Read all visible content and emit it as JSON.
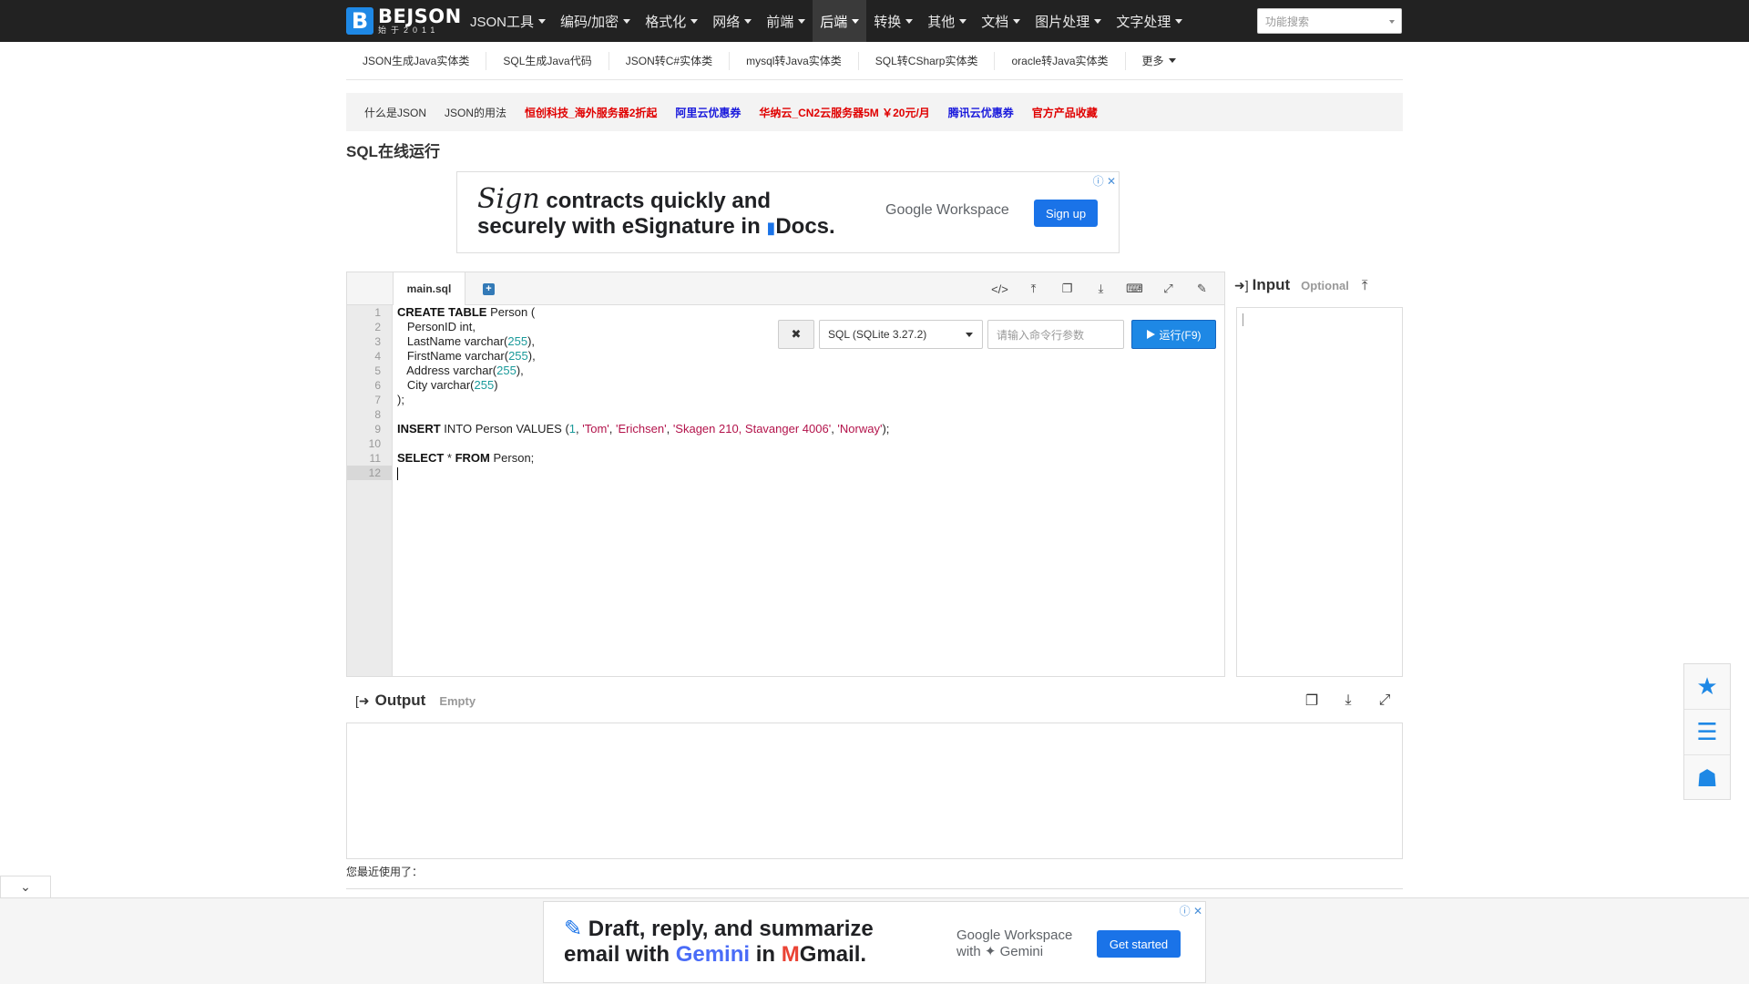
{
  "brand": {
    "name": "BEJSON",
    "tagline": "始于2011"
  },
  "nav": {
    "items": [
      "JSON工具",
      "编码/加密",
      "格式化",
      "网络",
      "前端",
      "后端",
      "转换",
      "其他",
      "文档",
      "图片处理",
      "文字处理"
    ],
    "active_index": 5,
    "search_placeholder": "功能搜索"
  },
  "subnav": [
    "JSON生成Java实体类",
    "SQL生成Java代码",
    "JSON转C#实体类",
    "mysql转Java实体类",
    "SQL转CSharp实体类",
    "oracle转Java实体类",
    "更多"
  ],
  "links": [
    {
      "text": "什么是JSON",
      "style": "plain"
    },
    {
      "text": "JSON的用法",
      "style": "plain"
    },
    {
      "text": "恒创科技_海外服务器2折起",
      "style": "red"
    },
    {
      "text": "阿里云优惠券",
      "style": "blue"
    },
    {
      "text": "华纳云_CN2云服务器5M ￥20元/月",
      "style": "red"
    },
    {
      "text": "腾讯云优惠券",
      "style": "blue"
    },
    {
      "text": "官方产品收藏",
      "style": "red"
    }
  ],
  "page_title": "SQL在线运行",
  "ad_top": {
    "script_word": "Sign",
    "line1": "contracts quickly and",
    "line2": "securely with eSignature in ",
    "line2_end": "Docs.",
    "brand": "Google Workspace",
    "button": "Sign up"
  },
  "editor": {
    "tab": "main.sql",
    "line_numbers": [
      "1",
      "2",
      "3",
      "4",
      "5",
      "6",
      "7",
      "8",
      "9",
      "10",
      "11",
      "12"
    ],
    "clear_label": "✖",
    "language": "SQL (SQLite 3.27.2)",
    "args_placeholder": "请输入命令行参数",
    "run_label": "运行(F9)"
  },
  "input_panel": {
    "title": "Input",
    "hint": "Optional"
  },
  "output_panel": {
    "title": "Output",
    "status": "Empty"
  },
  "recent_label": "您最近使用了：",
  "ad_bottom": {
    "line1": "Draft, reply, and summarize",
    "line2a": "email with ",
    "line2b": "Gemini",
    "line2c": " in ",
    "line2d": "Gmail.",
    "brand1": "Google Workspace",
    "brand2": "with ✦ Gemini",
    "button": "Get started"
  },
  "colors": {
    "accent": "#1e88e5",
    "nav_bg": "#222222",
    "link_red": "#e00000",
    "link_blue": "#1a1adc"
  },
  "icons": {
    "toolbar": [
      "code-icon",
      "upload-icon",
      "copy-icon",
      "download-icon",
      "keyboard-icon",
      "fullscreen-icon",
      "edit-icon"
    ],
    "float": [
      "star-icon",
      "menu-icon",
      "qq-icon"
    ]
  }
}
